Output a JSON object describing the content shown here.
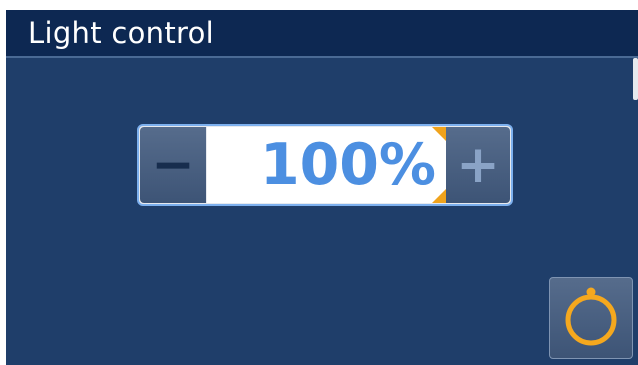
{
  "window": {
    "title": "Light control"
  },
  "stepper": {
    "value": "100%",
    "decrement_label": "−",
    "increment_label": "+"
  },
  "icons": {
    "power": "power-icon",
    "decrement": "minus-icon",
    "increment": "plus-icon"
  },
  "colors": {
    "background": "#1f3e6a",
    "titlebar": "#0d2852",
    "value_text": "#4c8fe1",
    "accent": "#f0a31c",
    "focus_border": "#7db0ee"
  }
}
